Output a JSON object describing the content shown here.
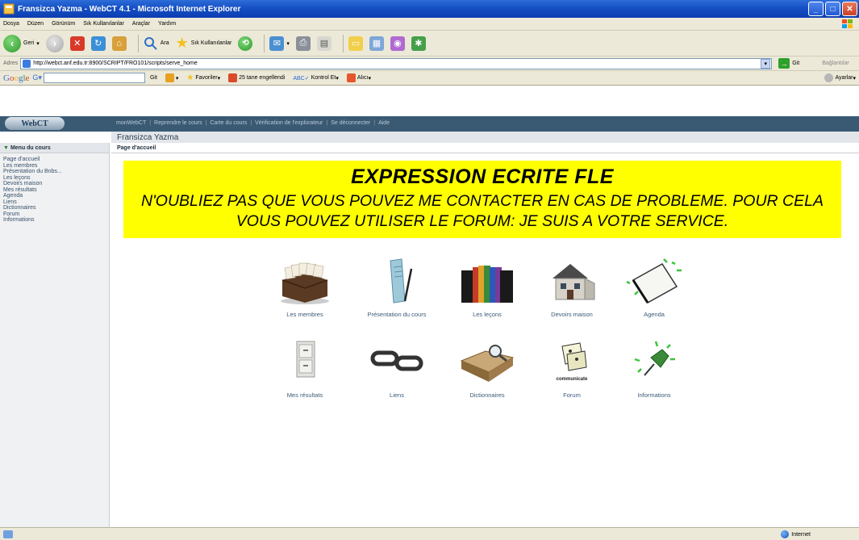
{
  "window": {
    "title": "Fransizca Yazma - WebCT 4.1 - Microsoft Internet Explorer",
    "buttons": {
      "minimize": "_",
      "maximize": "□",
      "close": "✕"
    }
  },
  "menu": [
    "Dosya",
    "Düzen",
    "Görünüm",
    "Sık Kullanılanlar",
    "Araçlar",
    "Yardım"
  ],
  "toolbar": {
    "back": "Geri",
    "search": "Ara",
    "favorites": "Sık Kullanılanlar"
  },
  "address": {
    "label": "Adres",
    "url": "http://webct.anf.edu.tr:8900/SCRIPT/FRO101/scripts/serve_home",
    "go": "Git",
    "links": "Bağlantılar"
  },
  "google_bar": {
    "logo": "Google",
    "go": "Git",
    "favorites": "Favoriler",
    "blocked": "25 tane engellendi",
    "spellcheck": "Kontrol Et",
    "send": "Alıcı",
    "settings": "Ayarlar"
  },
  "webct": {
    "logo": "WebCT",
    "nav": [
      "monWebCT",
      "Reprendre le cours",
      "Carte du cours",
      "Vérification de l'explorateur",
      "Se déconnecter",
      "Aide"
    ],
    "course_title": "Fransizca Yazma"
  },
  "sidebar": {
    "heading": "Menu du cours",
    "items": [
      "Page d'accueil",
      "Les membres",
      "Présentation du Bnbs...",
      "Les leçons",
      "Devoirs maison",
      "Mes résultats",
      "Agenda",
      "Liens",
      "Dictionnaires",
      "Forum",
      "Informations"
    ]
  },
  "main": {
    "heading": "Page d'accueil",
    "banner_title": "EXPRESSION ECRITE FLE",
    "banner_line1": "N'OUBLIEZ PAS QUE VOUS POUVEZ ME CONTACTER EN CAS DE PROBLEME. POUR CELA",
    "banner_line2": "VOUS POUVEZ UTILISER LE FORUM: JE SUIS A VOTRE SERVICE.",
    "tools": [
      {
        "label": "Les membres",
        "icon": "card-file-icon"
      },
      {
        "label": "Présentation du cours",
        "icon": "document-pen-icon"
      },
      {
        "label": "Les leçons",
        "icon": "binders-icon"
      },
      {
        "label": "Devoirs maison",
        "icon": "house-icon"
      },
      {
        "label": "Agenda",
        "icon": "calendar-icon"
      },
      {
        "label": "Mes résultats",
        "icon": "file-cabinet-icon"
      },
      {
        "label": "Liens",
        "icon": "chain-links-icon"
      },
      {
        "label": "Dictionnaires",
        "icon": "book-magnifier-icon"
      },
      {
        "label": "Forum",
        "icon": "communicate-icon",
        "caption": "communicate"
      },
      {
        "label": "Informations",
        "icon": "pushpin-icon"
      }
    ]
  },
  "status": {
    "zone": "Internet"
  },
  "colors": {
    "webct_header": "#3a5a74",
    "banner": "#ffff00",
    "link": "#3b5a78"
  }
}
